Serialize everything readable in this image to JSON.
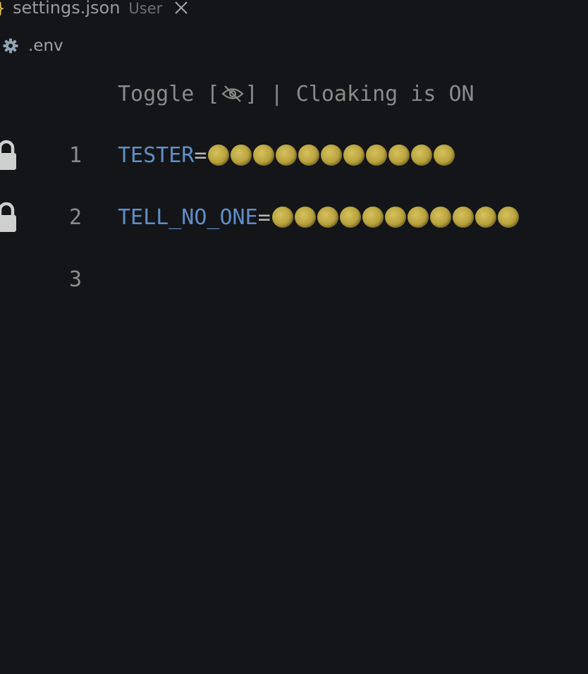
{
  "tab": {
    "icon": "curly-brace-icon",
    "icon_glyph": "}",
    "title": "settings.json",
    "description": "User"
  },
  "breadcrumb": {
    "icon": "gear-icon",
    "label": ".env"
  },
  "codelens": {
    "prefix": "Toggle [",
    "icon": "eye-off-icon",
    "suffix": "] | Cloaking is ON"
  },
  "editor": {
    "lines": [
      {
        "number": "1",
        "key": "TESTER",
        "eq": "=",
        "masked": true,
        "locked": true,
        "mask_count": 11
      },
      {
        "number": "2",
        "key": "TELL_NO_ONE",
        "eq": "=",
        "masked": true,
        "locked": true,
        "mask_count": 11
      },
      {
        "number": "3",
        "key": "",
        "eq": "",
        "masked": false,
        "locked": false,
        "mask_count": 0
      }
    ]
  },
  "colors": {
    "background": "#141518",
    "key": "#5f8ec6",
    "mask": "#c7b24a",
    "tab_icon": "#e8c547"
  }
}
